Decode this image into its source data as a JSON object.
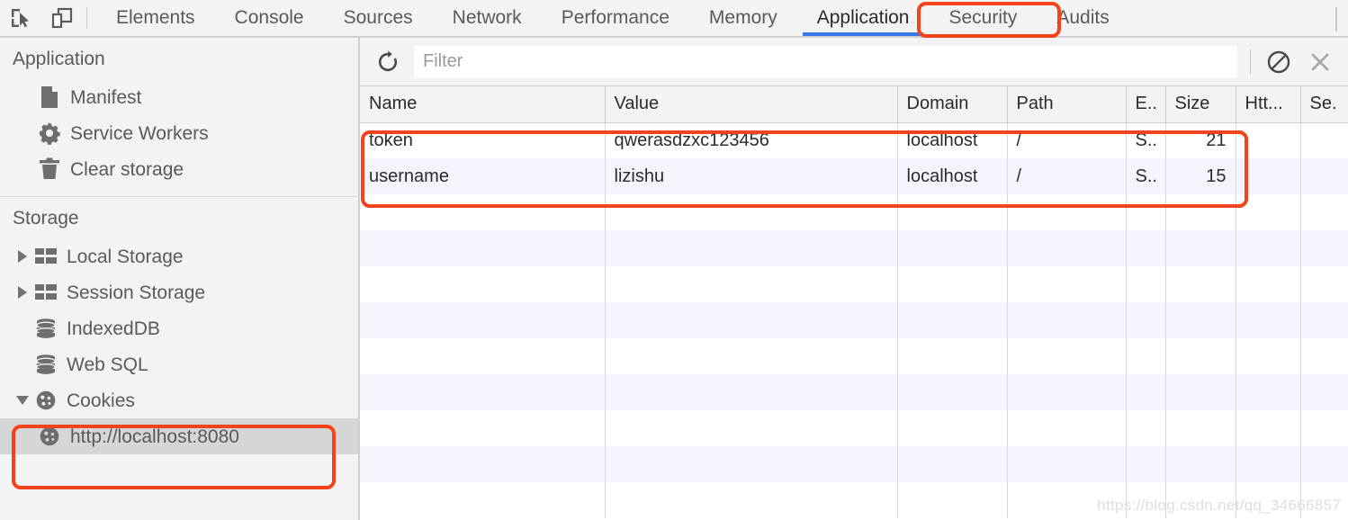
{
  "toolbar": {
    "inspect_icon": "inspect-element-icon",
    "device_icon": "device-toolbar-icon"
  },
  "tabs": [
    {
      "label": "Elements",
      "active": false
    },
    {
      "label": "Console",
      "active": false
    },
    {
      "label": "Sources",
      "active": false
    },
    {
      "label": "Network",
      "active": false
    },
    {
      "label": "Performance",
      "active": false
    },
    {
      "label": "Memory",
      "active": false
    },
    {
      "label": "Application",
      "active": true
    },
    {
      "label": "Security",
      "active": false
    },
    {
      "label": "Audits",
      "active": false
    }
  ],
  "sidebar": {
    "application_section": {
      "title": "Application",
      "items": [
        {
          "label": "Manifest",
          "icon": "manifest-document-icon"
        },
        {
          "label": "Service Workers",
          "icon": "gear-icon"
        },
        {
          "label": "Clear storage",
          "icon": "trash-icon"
        }
      ]
    },
    "storage_section": {
      "title": "Storage",
      "items": [
        {
          "label": "Local Storage",
          "icon": "table-grid-icon",
          "twisty": "collapsed"
        },
        {
          "label": "Session Storage",
          "icon": "table-grid-icon",
          "twisty": "collapsed"
        },
        {
          "label": "IndexedDB",
          "icon": "database-icon",
          "twisty": "none"
        },
        {
          "label": "Web SQL",
          "icon": "database-icon",
          "twisty": "none"
        },
        {
          "label": "Cookies",
          "icon": "cookie-icon",
          "twisty": "expanded"
        }
      ],
      "cookie_origin": {
        "label": "http://localhost:8080",
        "icon": "cookie-icon",
        "selected": true
      }
    }
  },
  "filterbar": {
    "refresh_icon": "refresh-icon",
    "placeholder": "Filter",
    "value": "",
    "clear_all_icon": "clear-all-cookies-icon",
    "delete_icon": "delete-selected-icon"
  },
  "table": {
    "columns": [
      "Name",
      "Value",
      "Domain",
      "Path",
      "E..",
      "Size",
      "Htt...",
      "Se."
    ],
    "rows": [
      {
        "name": "token",
        "value": "qwerasdzxc123456",
        "domain": "localhost",
        "path": "/",
        "expires": "S..",
        "size": "21",
        "httponly": "",
        "secure": ""
      },
      {
        "name": "username",
        "value": "lizishu",
        "domain": "localhost",
        "path": "/",
        "expires": "S..",
        "size": "15",
        "httponly": "",
        "secure": ""
      }
    ]
  },
  "annotations": {
    "color": "#f4421a",
    "targets": [
      "application-tab",
      "cookies-tree-node",
      "cookie-rows"
    ]
  },
  "watermark": "https://blog.csdn.net/qq_34666857"
}
